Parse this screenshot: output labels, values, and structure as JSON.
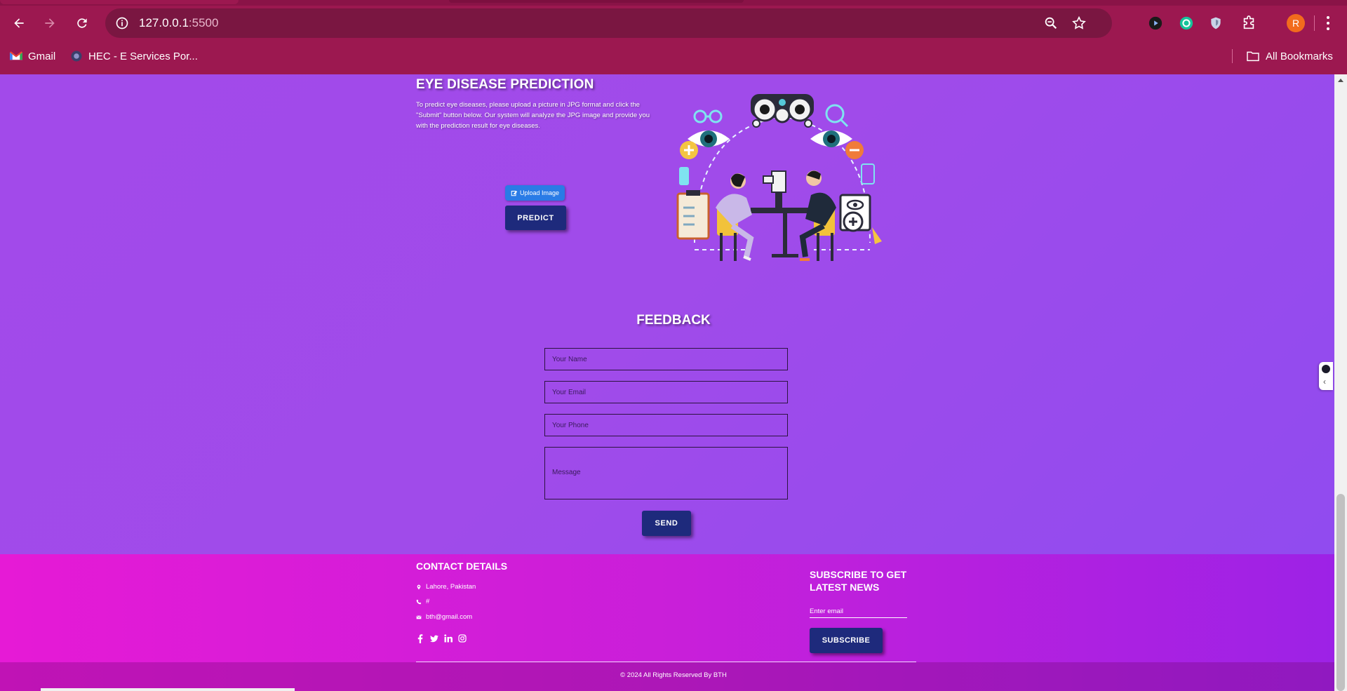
{
  "browser": {
    "url_host": "127.0.0.1",
    "url_port": ":5500",
    "profile_initial": "R",
    "bookmarks": [
      {
        "label": "Gmail",
        "icon": "gmail-icon"
      },
      {
        "label": "HEC - E Services Por...",
        "icon": "hec-icon"
      }
    ],
    "all_bookmarks_label": "All Bookmarks"
  },
  "prediction": {
    "title": "EYE DISEASE PREDICTION",
    "description": "To predict eye diseases, please upload a picture in JPG format and click the \"Submit\" button below. Our system will analyze the JPG image and provide you with the prediction result for eye diseases.",
    "upload_label": "Upload Image",
    "predict_label": "PREDICT"
  },
  "feedback": {
    "title": "FEEDBACK",
    "name_placeholder": "Your Name",
    "email_placeholder": "Your Email",
    "phone_placeholder": "Your Phone",
    "message_placeholder": "Message",
    "send_label": "SEND"
  },
  "footer": {
    "contact_title": "CONTACT DETAILS",
    "location": "Lahore, Pakistan",
    "phone": "#",
    "email": "bth@gmail.com",
    "socials": [
      "facebook-icon",
      "twitter-icon",
      "linkedin-icon",
      "instagram-icon"
    ],
    "subscribe_title": "SUBSCRIBE TO GET LATEST NEWS",
    "email_placeholder": "Enter email",
    "subscribe_label": "SUBSCRIBE",
    "copyright": "© 2024 All Rights Reserved By BTH"
  },
  "colors": {
    "chrome": "#9c1850",
    "page_bg": "#a04bea",
    "button": "#1e2a7c",
    "upload_button": "#2a7be6",
    "footer_start": "#e61ad6",
    "footer_end": "#9c22e6"
  }
}
